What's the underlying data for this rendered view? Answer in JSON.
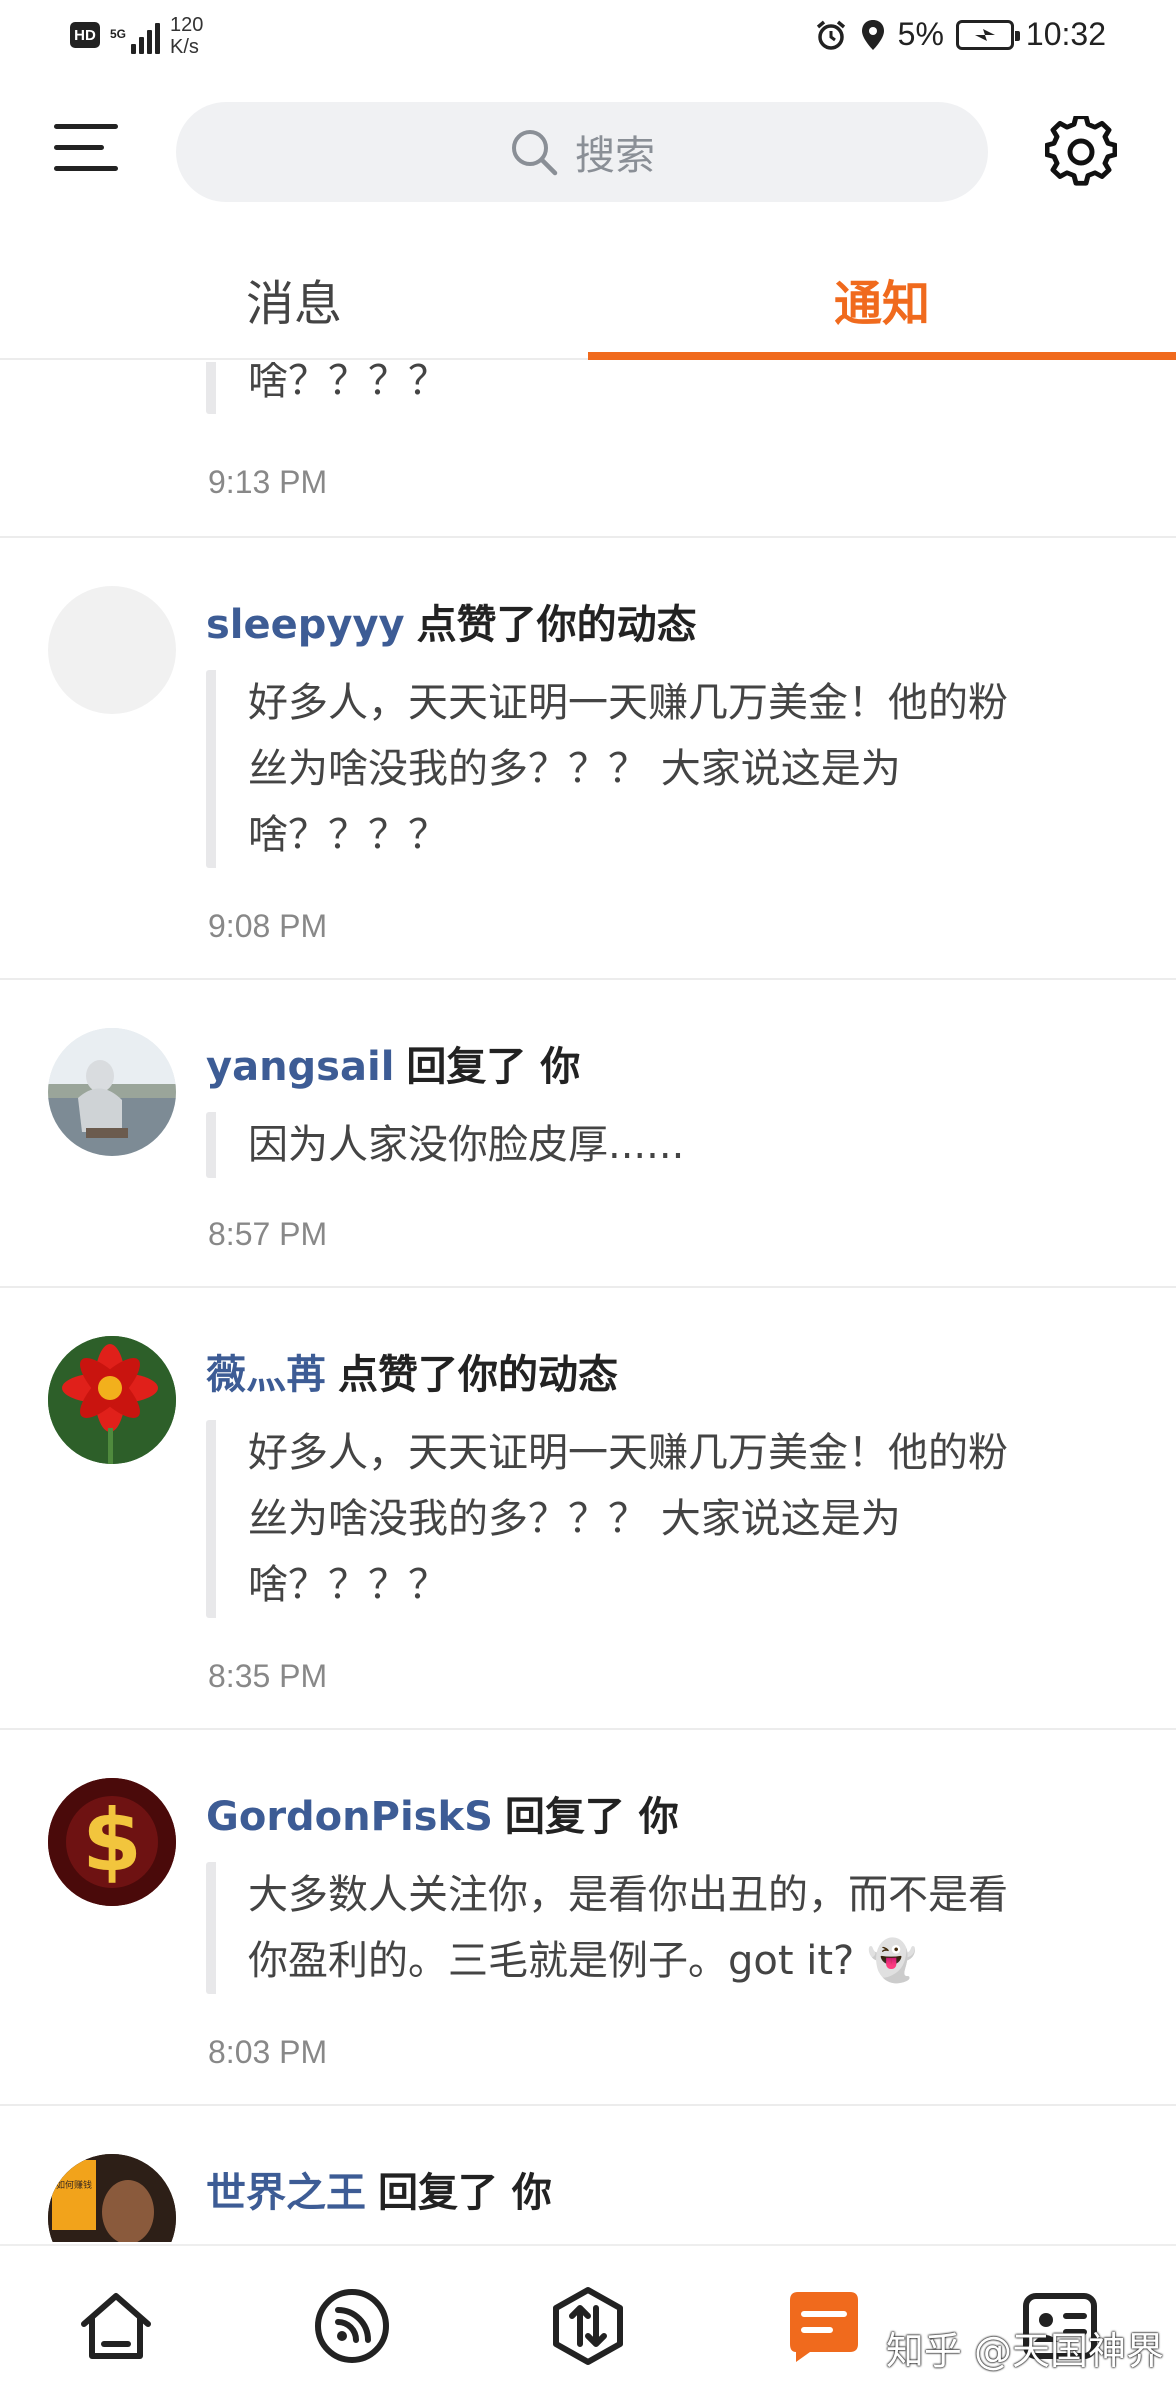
{
  "status_bar": {
    "hd": "HD",
    "network": "5G",
    "net_speed_value": "120",
    "net_speed_unit": "K/s",
    "battery": "5%",
    "time": "10:32"
  },
  "header": {
    "search_placeholder": "搜索"
  },
  "tabs": [
    {
      "label": "消息",
      "active": false
    },
    {
      "label": "通知",
      "active": true
    }
  ],
  "colors": {
    "accent": "#f06a1d",
    "username": "#3d5c95"
  },
  "notifications": [
    {
      "partial": true,
      "lines": [
        "啥？？？？"
      ],
      "time": "9:13 PM"
    },
    {
      "user": "sleepyyy",
      "action": "点赞了你的动态",
      "lines": [
        "好多人，天天证明一天赚几万美金！他的粉",
        "丝为啥没我的多？？？ 大家说这是为",
        "啥？？？？"
      ],
      "time": "9:08 PM"
    },
    {
      "user": "yangsail",
      "action": "回复了 你",
      "lines": [
        "因为人家没你脸皮厚......"
      ],
      "time": "8:57 PM"
    },
    {
      "user": "薇灬苒",
      "action": "点赞了你的动态",
      "lines": [
        "好多人，天天证明一天赚几万美金！他的粉",
        "丝为啥没我的多？？？ 大家说这是为",
        "啥？？？？"
      ],
      "time": "8:35 PM"
    },
    {
      "user": "GordonPiskS",
      "action": "回复了 你",
      "lines": [
        "大多数人关注你，是看你出丑的，而不是看",
        "你盈利的。三毛就是例子。got it? 👻"
      ],
      "time": "8:03 PM"
    },
    {
      "user": "世界之王",
      "action": "回复了 你",
      "avatar_text": "如何赚钱",
      "lines": [],
      "time": ""
    }
  ],
  "bottom_nav": {
    "icons": [
      "home-icon",
      "feed-icon",
      "trade-icon",
      "message-icon",
      "profile-icon"
    ],
    "active": "message-icon",
    "watermark": "知乎 @天国神界"
  }
}
